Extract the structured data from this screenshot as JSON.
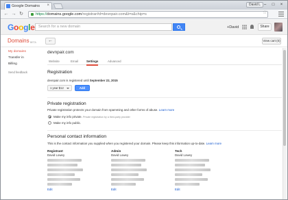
{
  "browser": {
    "tab_title": "Google Domains",
    "url_scheme": "https://",
    "url_host": "domains.google.com",
    "url_path": "/registrar#d=devnpair.com&t=s&chip=s",
    "profile_chip": "David L"
  },
  "header": {
    "logo": [
      "G",
      "o",
      "o",
      "g",
      "l",
      "e"
    ],
    "search_placeholder": "Search for a new domain",
    "plus_user": "+David",
    "share_label": "Share"
  },
  "subheader": {
    "title": "Domains",
    "beta": "BETA",
    "back_label": "←",
    "view_cart": "View cart (0)"
  },
  "sidebar": {
    "items": [
      {
        "label": "My domains"
      },
      {
        "label": "Transfer in"
      },
      {
        "label": "Billing"
      },
      {
        "label": "Send feedback"
      }
    ]
  },
  "main": {
    "domain": "devnpair.com",
    "tabs": [
      {
        "label": "Website"
      },
      {
        "label": "Email"
      },
      {
        "label": "Settings"
      },
      {
        "label": "Advanced"
      }
    ],
    "registration": {
      "heading": "Registration",
      "text_prefix": "devnpair.com is registered until ",
      "text_date": "September 22, 2015",
      "select_value": "1 year $12",
      "add_label": "Add"
    },
    "privacy": {
      "heading": "Private registration",
      "text": "Private registration protects your domain from spamming and other forms of abuse.",
      "learn_more": "Learn more",
      "option_private": "Make my info private.",
      "option_private_note": "Private registration by a third-party provider",
      "option_public": "Make my info public."
    },
    "contact": {
      "heading": "Personal contact information",
      "text": "This is the contact information you supplied when you registered your domain. Please keep this information up-to-date.",
      "learn_more": "Learn more",
      "columns": [
        {
          "title": "Registrant",
          "name": "David Lowey",
          "edit": "Edit"
        },
        {
          "title": "Admin",
          "name": "David Lowey",
          "edit": "Edit"
        },
        {
          "title": "Tech",
          "name": "David Lowey",
          "edit": "Edit"
        }
      ]
    }
  }
}
